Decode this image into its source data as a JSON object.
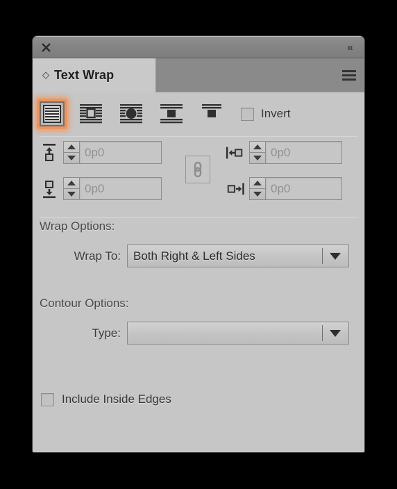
{
  "window": {
    "close_icon": "close-icon",
    "collapse_icon": "double-chevron-left-icon",
    "collapse_label": "«"
  },
  "tab": {
    "diamond_glyph": "◇",
    "label": "Text Wrap",
    "panel_menu_icon": "hamburger-menu-icon"
  },
  "wrap_modes": {
    "selected_index": 0,
    "highlight_color": "#f0945a",
    "buttons": [
      {
        "name": "no-text-wrap",
        "icon": "no-text-wrap-icon",
        "selected": true
      },
      {
        "name": "wrap-around-bounding-box",
        "icon": "wrap-bounding-box-icon",
        "selected": false
      },
      {
        "name": "wrap-around-object-shape",
        "icon": "wrap-object-shape-icon",
        "selected": false
      },
      {
        "name": "jump-object",
        "icon": "jump-object-icon",
        "selected": false
      },
      {
        "name": "jump-to-next-column",
        "icon": "jump-next-column-icon",
        "selected": false
      }
    ],
    "invert": {
      "label": "Invert",
      "checked": false
    }
  },
  "offsets": {
    "top": {
      "icon": "offset-top-icon",
      "value": "0p0"
    },
    "bottom": {
      "icon": "offset-bottom-icon",
      "value": "0p0"
    },
    "left": {
      "icon": "offset-left-icon",
      "value": "0p0"
    },
    "right": {
      "icon": "offset-right-icon",
      "value": "0p0"
    },
    "link": {
      "icon": "chain-link-icon",
      "linked": false
    }
  },
  "wrap_options": {
    "heading": "Wrap Options:",
    "wrap_to_label": "Wrap To:",
    "wrap_to_value": "Both Right & Left Sides"
  },
  "contour_options": {
    "heading": "Contour Options:",
    "type_label": "Type:",
    "type_value": ""
  },
  "include_inside_edges": {
    "label": "Include Inside Edges",
    "checked": false
  },
  "colors": {
    "panel_bg": "#c6c6c6",
    "titlebar_bg": "#848484",
    "tabstrip_bg": "#8a8a8a",
    "active_tab_bg": "#c9c9c9",
    "accent": "#f0945a",
    "outside_bg": "#000000"
  }
}
